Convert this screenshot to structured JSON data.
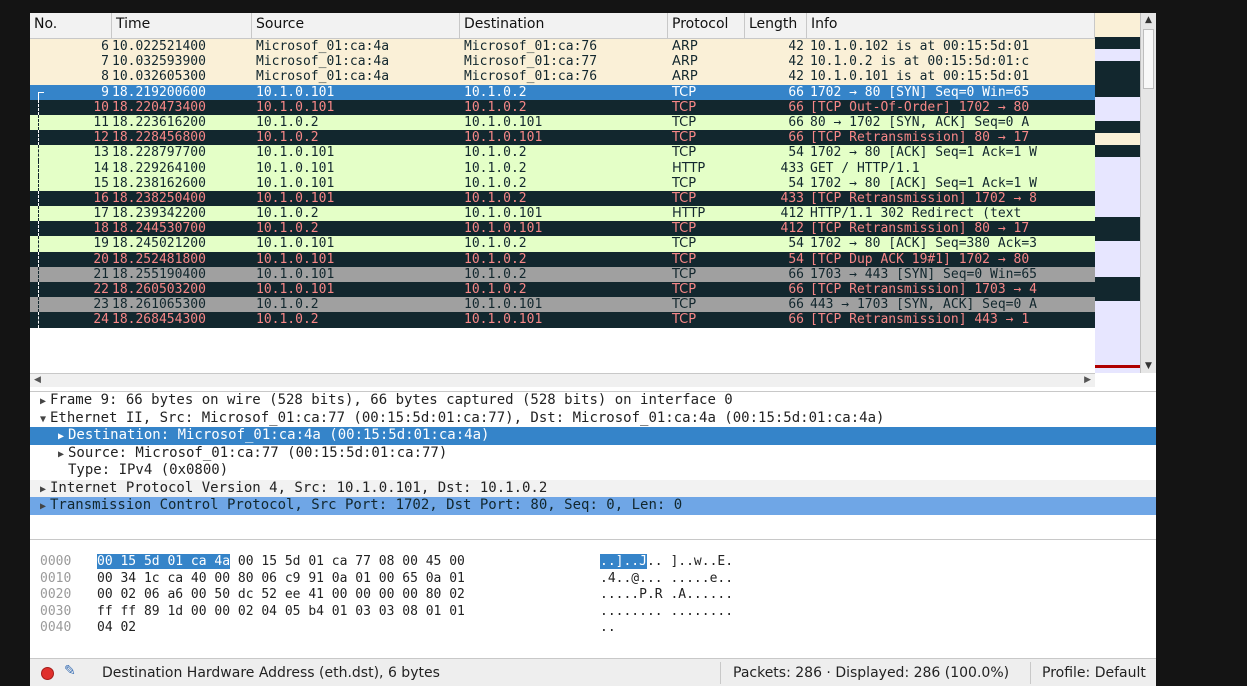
{
  "columns": {
    "no": "No.",
    "time": "Time",
    "source": "Source",
    "destination": "Destination",
    "protocol": "Protocol",
    "length": "Length",
    "info": "Info"
  },
  "packets": [
    {
      "no": "6",
      "time": "10.022521400",
      "src": "Microsof_01:ca:4a",
      "dst": "Microsof_01:ca:76",
      "proto": "ARP",
      "len": "42",
      "info": "10.1.0.102 is at 00:15:5d:01",
      "style": "arp"
    },
    {
      "no": "7",
      "time": "10.032593900",
      "src": "Microsof_01:ca:4a",
      "dst": "Microsof_01:ca:77",
      "proto": "ARP",
      "len": "42",
      "info": "10.1.0.2 is at 00:15:5d:01:c",
      "style": "arp"
    },
    {
      "no": "8",
      "time": "10.032605300",
      "src": "Microsof_01:ca:4a",
      "dst": "Microsof_01:ca:76",
      "proto": "ARP",
      "len": "42",
      "info": "10.1.0.101 is at 00:15:5d:01",
      "style": "arp"
    },
    {
      "no": "9",
      "time": "18.219200600",
      "src": "10.1.0.101",
      "dst": "10.1.0.2",
      "proto": "TCP",
      "len": "66",
      "info": "1702 → 80 [SYN] Seq=0 Win=65",
      "style": "sel"
    },
    {
      "no": "10",
      "time": "18.220473400",
      "src": "10.1.0.101",
      "dst": "10.1.0.2",
      "proto": "TCP",
      "len": "66",
      "info": "[TCP Out-Of-Order] 1702 → 80",
      "style": "bad"
    },
    {
      "no": "11",
      "time": "18.223616200",
      "src": "10.1.0.2",
      "dst": "10.1.0.101",
      "proto": "TCP",
      "len": "66",
      "info": "80 → 1702 [SYN, ACK] Seq=0 A",
      "style": "http"
    },
    {
      "no": "12",
      "time": "18.228456800",
      "src": "10.1.0.2",
      "dst": "10.1.0.101",
      "proto": "TCP",
      "len": "66",
      "info": "[TCP Retransmission] 80 → 17",
      "style": "bad"
    },
    {
      "no": "13",
      "time": "18.228797700",
      "src": "10.1.0.101",
      "dst": "10.1.0.2",
      "proto": "TCP",
      "len": "54",
      "info": "1702 → 80 [ACK] Seq=1 Ack=1 W",
      "style": "http"
    },
    {
      "no": "14",
      "time": "18.229264100",
      "src": "10.1.0.101",
      "dst": "10.1.0.2",
      "proto": "HTTP",
      "len": "433",
      "info": "GET / HTTP/1.1",
      "style": "http"
    },
    {
      "no": "15",
      "time": "18.238162600",
      "src": "10.1.0.101",
      "dst": "10.1.0.2",
      "proto": "TCP",
      "len": "54",
      "info": "1702 → 80 [ACK] Seq=1 Ack=1 W",
      "style": "http"
    },
    {
      "no": "16",
      "time": "18.238250400",
      "src": "10.1.0.101",
      "dst": "10.1.0.2",
      "proto": "TCP",
      "len": "433",
      "info": "[TCP Retransmission] 1702 → 8",
      "style": "bad"
    },
    {
      "no": "17",
      "time": "18.239342200",
      "src": "10.1.0.2",
      "dst": "10.1.0.101",
      "proto": "HTTP",
      "len": "412",
      "info": "HTTP/1.1 302 Redirect  (text",
      "style": "http"
    },
    {
      "no": "18",
      "time": "18.244530700",
      "src": "10.1.0.2",
      "dst": "10.1.0.101",
      "proto": "TCP",
      "len": "412",
      "info": "[TCP Retransmission] 80 → 17",
      "style": "bad"
    },
    {
      "no": "19",
      "time": "18.245021200",
      "src": "10.1.0.101",
      "dst": "10.1.0.2",
      "proto": "TCP",
      "len": "54",
      "info": "1702 → 80 [ACK] Seq=380 Ack=3",
      "style": "http"
    },
    {
      "no": "20",
      "time": "18.252481800",
      "src": "10.1.0.101",
      "dst": "10.1.0.2",
      "proto": "TCP",
      "len": "54",
      "info": "[TCP Dup ACK 19#1] 1702 → 80",
      "style": "bad"
    },
    {
      "no": "21",
      "time": "18.255190400",
      "src": "10.1.0.101",
      "dst": "10.1.0.2",
      "proto": "TCP",
      "len": "66",
      "info": "1703 → 443 [SYN] Seq=0 Win=65",
      "style": "gray"
    },
    {
      "no": "22",
      "time": "18.260503200",
      "src": "10.1.0.101",
      "dst": "10.1.0.2",
      "proto": "TCP",
      "len": "66",
      "info": "[TCP Retransmission] 1703 → 4",
      "style": "bad"
    },
    {
      "no": "23",
      "time": "18.261065300",
      "src": "10.1.0.2",
      "dst": "10.1.0.101",
      "proto": "TCP",
      "len": "66",
      "info": "443 → 1703 [SYN, ACK] Seq=0 A",
      "style": "gray"
    },
    {
      "no": "24",
      "time": "18.268454300",
      "src": "10.1.0.2",
      "dst": "10.1.0.101",
      "proto": "TCP",
      "len": "66",
      "info": "[TCP Retransmission] 443 → 1",
      "style": "bad"
    }
  ],
  "details": [
    {
      "text": "Frame 9: 66 bytes on wire (528 bits), 66 bytes captured (528 bits) on interface 0",
      "indent": 0,
      "tri": "▶",
      "style": ""
    },
    {
      "text": "Ethernet II, Src: Microsof_01:ca:77 (00:15:5d:01:ca:77), Dst: Microsof_01:ca:4a (00:15:5d:01:ca:4a)",
      "indent": 0,
      "tri": "▼",
      "style": ""
    },
    {
      "text": "Destination: Microsof_01:ca:4a (00:15:5d:01:ca:4a)",
      "indent": 1,
      "tri": "▶",
      "style": "d-sel"
    },
    {
      "text": "Source: Microsof_01:ca:77 (00:15:5d:01:ca:77)",
      "indent": 1,
      "tri": "▶",
      "style": ""
    },
    {
      "text": "Type: IPv4 (0x0800)",
      "indent": 1,
      "tri": "",
      "style": ""
    },
    {
      "text": "Internet Protocol Version 4, Src: 10.1.0.101, Dst: 10.1.0.2",
      "indent": 0,
      "tri": "▶",
      "style": "d-alt"
    },
    {
      "text": "Transmission Control Protocol, Src Port: 1702, Dst Port: 80, Seq: 0, Len: 0",
      "indent": 0,
      "tri": "▶",
      "style": "d-hl"
    }
  ],
  "bytes": [
    {
      "offset": "0000",
      "hex_hl": "00 15 5d 01 ca 4a",
      "hex": " 00 15  5d 01 ca 77 08 00 45 00",
      "ascii_hl": "..]..J",
      "ascii": ".. ]..w..E."
    },
    {
      "offset": "0010",
      "hex_hl": "",
      "hex": "00 34 1c ca 40 00 80 06  c9 91 0a 01 00 65 0a 01",
      "ascii_hl": "",
      "ascii": ".4..@... .....e.."
    },
    {
      "offset": "0020",
      "hex_hl": "",
      "hex": "00 02 06 a6 00 50 dc 52  ee 41 00 00 00 00 80 02",
      "ascii_hl": "",
      "ascii": ".....P.R .A......"
    },
    {
      "offset": "0030",
      "hex_hl": "",
      "hex": "ff ff 89 1d 00 00 02 04  05 b4 01 03 03 08 01 01",
      "ascii_hl": "",
      "ascii": "........ ........"
    },
    {
      "offset": "0040",
      "hex_hl": "",
      "hex": "04 02",
      "ascii_hl": "",
      "ascii": ".."
    }
  ],
  "status": {
    "message": "Destination Hardware Address (eth.dst), 6 bytes",
    "packets": "Packets: 286 · Displayed: 286 (100.0%)",
    "profile": "Profile: Default"
  },
  "colors": {
    "selected": "#3584c9",
    "bad": "#12272e",
    "bad_text": "#f78787",
    "arp": "#faf0d7",
    "tcp_ok": "#e4ffc7",
    "gray": "#a0a0a0"
  }
}
